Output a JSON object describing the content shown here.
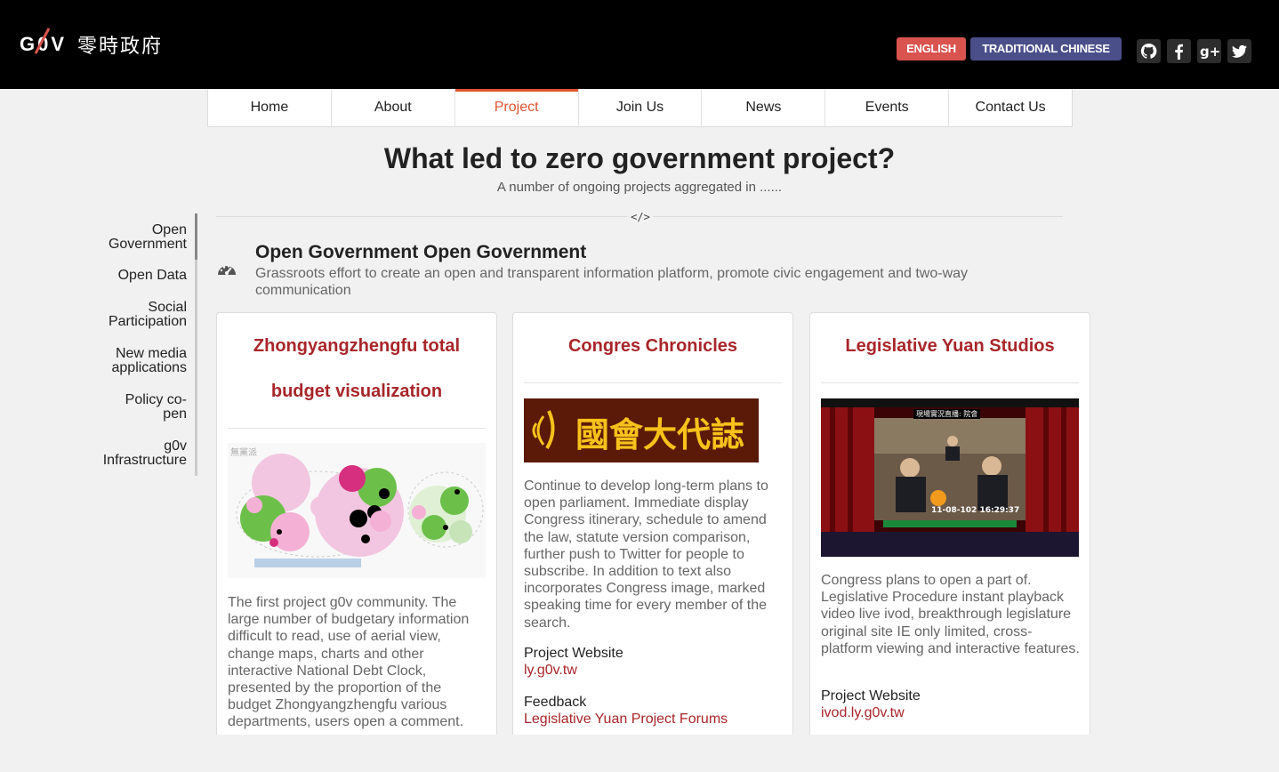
{
  "header": {
    "logo_text": "G0V",
    "logo_cn": "零時政府",
    "lang_english": "ENGLISH",
    "lang_traditional": "TRADITIONAL CHINESE",
    "social_icons": [
      "github-icon",
      "facebook-icon",
      "google-plus-icon",
      "twitter-icon"
    ],
    "accent_color": "#d9534f",
    "secondary_color": "#4a4f8a"
  },
  "nav": {
    "items": [
      "Home",
      "About",
      "Project",
      "Join Us",
      "News",
      "Events",
      "Contact Us"
    ],
    "active": "Project",
    "active_color": "#e0542e"
  },
  "page": {
    "title": "What led to zero government project?",
    "subtitle": "A number of ongoing projects aggregated in ......",
    "divider_icon": "</>"
  },
  "sidemenu": {
    "items": [
      [
        "Open",
        "Government"
      ],
      [
        "Open Data"
      ],
      [
        "Social",
        "Participation"
      ],
      [
        "New media",
        "applications"
      ],
      [
        "Policy co-",
        "pen"
      ],
      [
        "g0v",
        "Infrastructure"
      ]
    ]
  },
  "category": {
    "icon": "dashboard-icon",
    "title": "Open Government Open Government",
    "description": "Grassroots effort to create an open and transparent information platform, promote civic engagement and two-way communication"
  },
  "cards": [
    {
      "title_lines": [
        "Zhongyangzhengfu total",
        "budget visualization"
      ],
      "image": "budget-bubble-chart-image",
      "image_text": "無黨派",
      "text": "The first project g0v community. The large number of budgetary information difficult to read, use of aerial view, change maps, charts and other interactive National Debt Clock, presented by the proportion of the budget Zhongyangzhengfu various departments, users open a comment."
    },
    {
      "title_lines": [
        "Congres Chronicles"
      ],
      "image": "congress-chronicles-banner-image",
      "banner_text": "國會大代誌",
      "text": "Continue to develop long-term plans to open parliament. Immediate display Congress itinerary, schedule to amend the law, statute version comparison, further push to Twitter for people to subscribe. In addition to text also incorporates Congress image, marked speaking time for every member of the search.",
      "website_label": "Project Website",
      "website_link": "ly.g0v.tw",
      "feedback_label": "Feedback",
      "feedback_link": "Legislative Yuan Project Forums"
    },
    {
      "title_lines": [
        "Legislative Yuan Studios"
      ],
      "image": "legislative-video-screenshot-image",
      "video_caption": "現場實況直播: 院會",
      "video_timestamp": "11-08-102  16:29:37",
      "text": "Congress plans to open a part of. Legislative Procedure instant playback video live ivod, breakthrough legislature original site IE only limited, cross-platform viewing and interactive features.",
      "website_label": "Project Website",
      "website_link": "ivod.ly.g0v.tw"
    }
  ]
}
